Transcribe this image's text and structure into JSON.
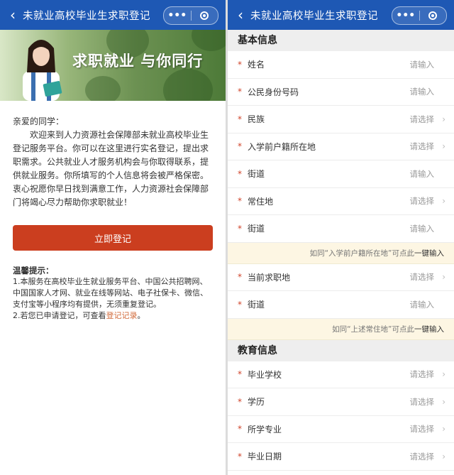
{
  "colors": {
    "nav": "#1e58b4",
    "primary_button": "#cb3e1f",
    "required_star": "#d0442a",
    "link": "#d26a3a",
    "hint_bg": "#fdf6e3"
  },
  "left": {
    "nav": {
      "back_icon": "chevron-left-icon",
      "title": "未就业高校毕业生求职登记",
      "more": "•••",
      "close_icon": "target-close-icon"
    },
    "banner": {
      "slogan": "求职就业 与你同行"
    },
    "intro": {
      "greeting": "亲爱的同学：",
      "body": "欢迎来到人力资源社会保障部未就业高校毕业生登记服务平台。你可以在这里进行实名登记，提出求职需求。公共就业人才服务机构会与你取得联系，提供就业服务。你所填写的个人信息将会被严格保密。衷心祝愿你早日找到满意工作，人力资源社会保障部门将竭心尽力帮助你求职就业！"
    },
    "register_button": "立即登记",
    "tips": {
      "title": "温馨提示：",
      "item1": "1.本服务在高校毕业生就业服务平台、中国公共招聘网、中国国家人才网、就业在线等网站、电子社保卡、微信、支付宝等小程序均有提供，无须重复登记。",
      "item2_prefix": "2.若您已申请登记，可查看",
      "item2_link": "登记记录",
      "item2_suffix": "。"
    }
  },
  "right": {
    "nav": {
      "back_icon": "chevron-left-icon",
      "title": "未就业高校毕业生求职登记",
      "more": "•••",
      "close_icon": "target-close-icon"
    },
    "section_basic": "基本信息",
    "basic_fields": [
      {
        "star": "*",
        "label": "姓名",
        "value": "请输入",
        "chevron": ""
      },
      {
        "star": "*",
        "label": "公民身份号码",
        "value": "请输入",
        "chevron": ""
      },
      {
        "star": "*",
        "label": "民族",
        "value": "请选择",
        "chevron": "›"
      },
      {
        "star": "*",
        "label": "入学前户籍所在地",
        "value": "请选择",
        "chevron": "›"
      },
      {
        "star": "*",
        "label": "街道",
        "value": "请输入",
        "chevron": ""
      },
      {
        "star": "*",
        "label": "常住地",
        "value": "请选择",
        "chevron": "›"
      },
      {
        "star": "*",
        "label": "街道",
        "value": "请输入",
        "chevron": ""
      }
    ],
    "hint1": {
      "prefix": "如同“入学前户籍所在地”可点此",
      "action": "一键输入"
    },
    "job_fields": [
      {
        "star": "*",
        "label": "当前求职地",
        "value": "请选择",
        "chevron": "›"
      },
      {
        "star": "*",
        "label": "街道",
        "value": "请输入",
        "chevron": ""
      }
    ],
    "hint2": {
      "prefix": "如同“上述常住地”可点此",
      "action": "一键输入"
    },
    "section_edu": "教育信息",
    "edu_fields": [
      {
        "star": "*",
        "label": "毕业学校",
        "value": "请选择",
        "chevron": "›"
      },
      {
        "star": "*",
        "label": "学历",
        "value": "请选择",
        "chevron": "›"
      },
      {
        "star": "*",
        "label": "所学专业",
        "value": "请选择",
        "chevron": "›"
      },
      {
        "star": "*",
        "label": "毕业日期",
        "value": "请选择",
        "chevron": "›"
      }
    ]
  }
}
